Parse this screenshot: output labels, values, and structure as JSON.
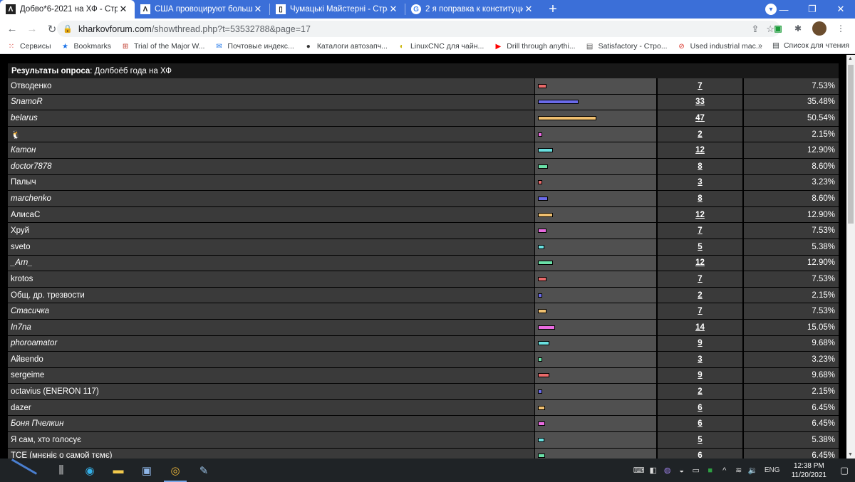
{
  "browser": {
    "tabs": [
      {
        "title": "Добво*6-2021 на ХФ - Страниц",
        "icon": "forum-icon",
        "active": true
      },
      {
        "title": "США провоцируют большую в",
        "icon": "forum-icon",
        "active": false
      },
      {
        "title": "Чумацькі Майстерні - Страниц",
        "icon": "forum-icon",
        "active": false
      },
      {
        "title": "2 я поправка к конституции сш",
        "icon": "google-icon",
        "active": false
      }
    ],
    "url_host": "kharkovforum.com",
    "url_path": "/showthread.php?t=53532788&page=17"
  },
  "bookmarks": {
    "items": [
      {
        "label": "Сервисы",
        "icon": "apps-grid-icon"
      },
      {
        "label": "Bookmarks",
        "icon": "star-icon"
      },
      {
        "label": "Trial of the Major W...",
        "icon": "page-icon"
      },
      {
        "label": "Почтовые индекс...",
        "icon": "mail-icon"
      },
      {
        "label": "Каталоги автозапч...",
        "icon": "globe-icon"
      },
      {
        "label": "LinuxCNC для чайн...",
        "icon": "lemon-icon"
      },
      {
        "label": "Drill through anythi...",
        "icon": "youtube-icon"
      },
      {
        "label": "Satisfactory - Стро...",
        "icon": "page-icon"
      },
      {
        "label": "Used industrial mac...",
        "icon": "blocked-icon"
      }
    ],
    "overflow": "»",
    "reading_list": "Список для чтения"
  },
  "poll": {
    "header_label": "Результаты опроса",
    "header_title": ": Долбоёб года на ХФ",
    "rows": [
      {
        "name": "Отводенко",
        "italic": false,
        "votes": "7",
        "pct": "7.53%",
        "fraction": 0.0753,
        "color": "#e96a6a"
      },
      {
        "name": "SnamoR",
        "italic": true,
        "votes": "33",
        "pct": "35.48%",
        "fraction": 0.3548,
        "color": "#6a6ae9"
      },
      {
        "name": "belarus",
        "italic": true,
        "votes": "47",
        "pct": "50.54%",
        "fraction": 0.5054,
        "color": "#f0c070"
      },
      {
        "name": "🐧",
        "italic": false,
        "votes": "2",
        "pct": "2.15%",
        "fraction": 0.0215,
        "color": "#e96ae0"
      },
      {
        "name": "Катон",
        "italic": true,
        "votes": "12",
        "pct": "12.90%",
        "fraction": 0.129,
        "color": "#6ae0e0"
      },
      {
        "name": "doctor7878",
        "italic": true,
        "votes": "8",
        "pct": "8.60%",
        "fraction": 0.086,
        "color": "#6ae0a8"
      },
      {
        "name": "Палыч",
        "italic": false,
        "votes": "3",
        "pct": "3.23%",
        "fraction": 0.0323,
        "color": "#e96a6a"
      },
      {
        "name": "marchenko",
        "italic": true,
        "votes": "8",
        "pct": "8.60%",
        "fraction": 0.086,
        "color": "#6a6ae9"
      },
      {
        "name": "АлисаС",
        "italic": false,
        "votes": "12",
        "pct": "12.90%",
        "fraction": 0.129,
        "color": "#f0c070"
      },
      {
        "name": "Хруй",
        "italic": false,
        "votes": "7",
        "pct": "7.53%",
        "fraction": 0.0753,
        "color": "#e96ae0"
      },
      {
        "name": "sveto",
        "italic": false,
        "votes": "5",
        "pct": "5.38%",
        "fraction": 0.0538,
        "color": "#6ae0e0"
      },
      {
        "name": "_Arn_",
        "italic": true,
        "votes": "12",
        "pct": "12.90%",
        "fraction": 0.129,
        "color": "#6ae0a8"
      },
      {
        "name": "krotos",
        "italic": false,
        "votes": "7",
        "pct": "7.53%",
        "fraction": 0.0753,
        "color": "#e96a6a"
      },
      {
        "name": "Общ. др. трезвости",
        "italic": false,
        "votes": "2",
        "pct": "2.15%",
        "fraction": 0.0215,
        "color": "#6a6ae9"
      },
      {
        "name": "Стасичка",
        "italic": true,
        "votes": "7",
        "pct": "7.53%",
        "fraction": 0.0753,
        "color": "#f0c070"
      },
      {
        "name": "In7na",
        "italic": true,
        "votes": "14",
        "pct": "15.05%",
        "fraction": 0.1505,
        "color": "#e96ae0"
      },
      {
        "name": "phoroamator",
        "italic": true,
        "votes": "9",
        "pct": "9.68%",
        "fraction": 0.0968,
        "color": "#6ae0e0"
      },
      {
        "name": "Айвendo",
        "italic": false,
        "votes": "3",
        "pct": "3.23%",
        "fraction": 0.0323,
        "color": "#6ae0a8"
      },
      {
        "name": "sergeime",
        "italic": false,
        "votes": "9",
        "pct": "9.68%",
        "fraction": 0.0968,
        "color": "#e96a6a"
      },
      {
        "name": "octavius (ENERON 117)",
        "italic": false,
        "votes": "2",
        "pct": "2.15%",
        "fraction": 0.0215,
        "color": "#6a6ae9"
      },
      {
        "name": "dazer",
        "italic": false,
        "votes": "6",
        "pct": "6.45%",
        "fraction": 0.0645,
        "color": "#f0c070"
      },
      {
        "name": "Боня Пчелкин",
        "italic": true,
        "votes": "6",
        "pct": "6.45%",
        "fraction": 0.0645,
        "color": "#e96ae0"
      },
      {
        "name": "Я сам, хто голосує",
        "italic": false,
        "votes": "5",
        "pct": "5.38%",
        "fraction": 0.0538,
        "color": "#6ae0e0"
      },
      {
        "name": "TCE (мнєніє о самой тємє)",
        "italic": false,
        "votes": "6",
        "pct": "6.45%",
        "fraction": 0.0645,
        "color": "#6ae0a8"
      }
    ]
  },
  "taskbar": {
    "language": "ENG",
    "time": "12:38 PM",
    "date": "11/20/2021"
  }
}
